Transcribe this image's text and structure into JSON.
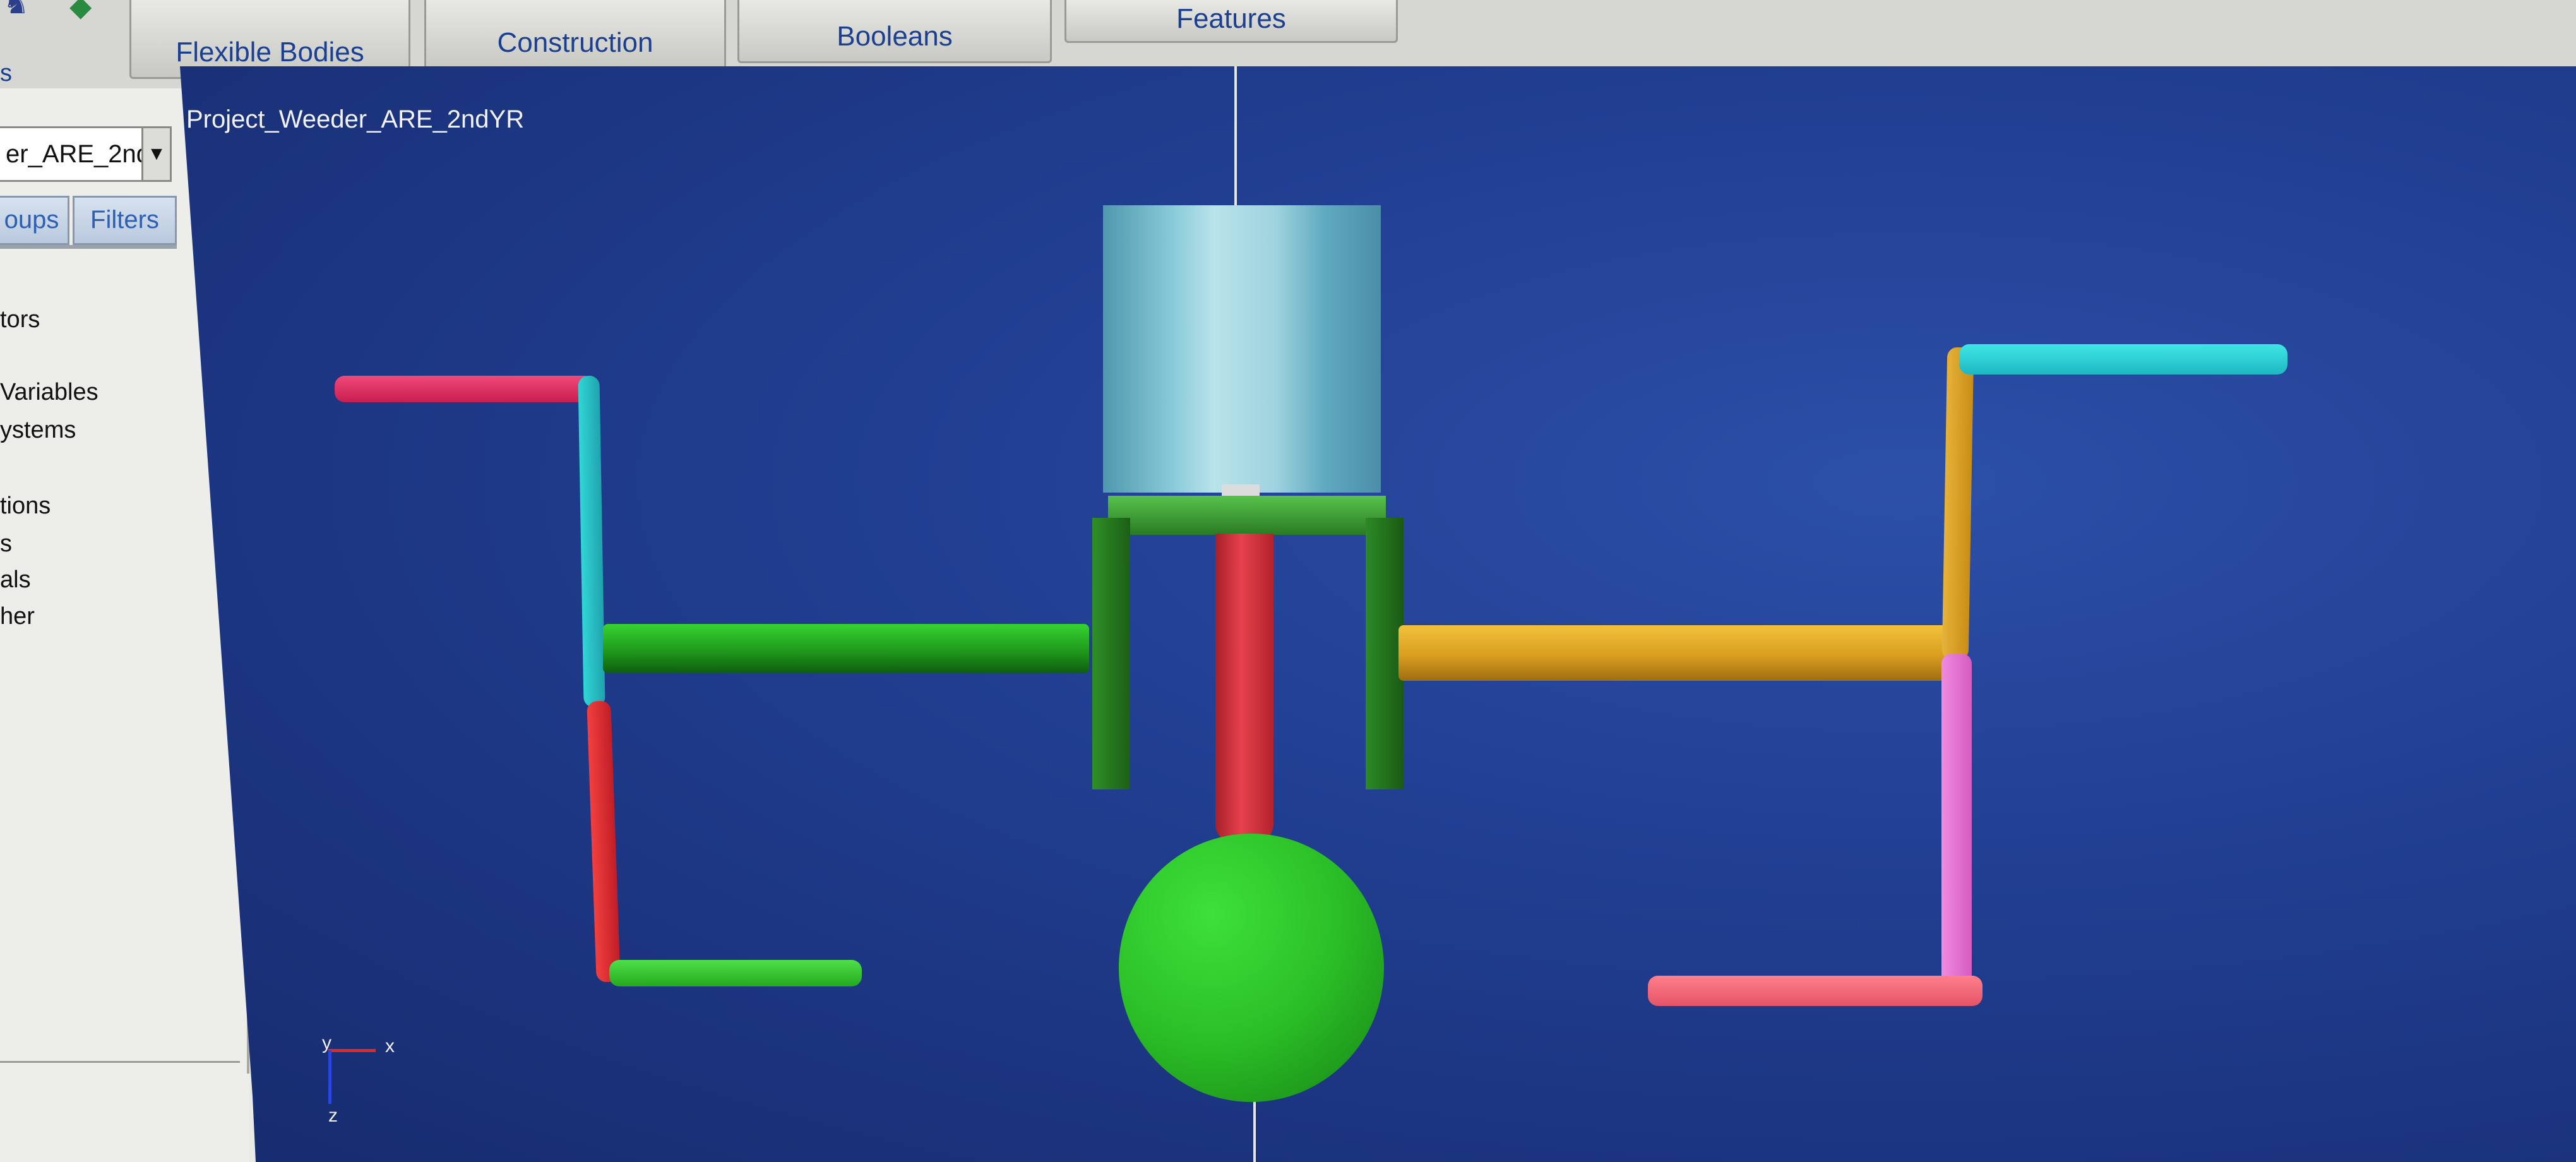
{
  "ribbon": {
    "tabs": [
      {
        "label": "Flexible Bodies"
      },
      {
        "label": "Construction"
      },
      {
        "label": "Booleans"
      },
      {
        "label": "Features"
      }
    ],
    "left_fragment": "s"
  },
  "left_panel": {
    "model_dropdown": "er_ARE_2nd",
    "tabs": [
      {
        "label": "oups"
      },
      {
        "label": "Filters"
      }
    ],
    "tree_items": [
      {
        "label": "tors"
      },
      {
        "label": "Variables"
      },
      {
        "label": "ystems"
      },
      {
        "label": "tions"
      },
      {
        "label": "s"
      },
      {
        "label": "als"
      },
      {
        "label": "her"
      }
    ]
  },
  "viewport": {
    "title": "Project_Weeder_ARE_2ndYR",
    "triad": {
      "x_label": "x",
      "y_label": "y",
      "z_label": "z"
    }
  },
  "colors": {
    "background": "#1f3b8c",
    "green": "#2fb52a",
    "red": "#d9303a",
    "cyan": "#2cc7cc",
    "gold": "#d6a428",
    "pink": "#e86fd0",
    "magenta": "#e0335f",
    "salmon": "#f06b7c",
    "cylinder": "#7fbcd0"
  }
}
